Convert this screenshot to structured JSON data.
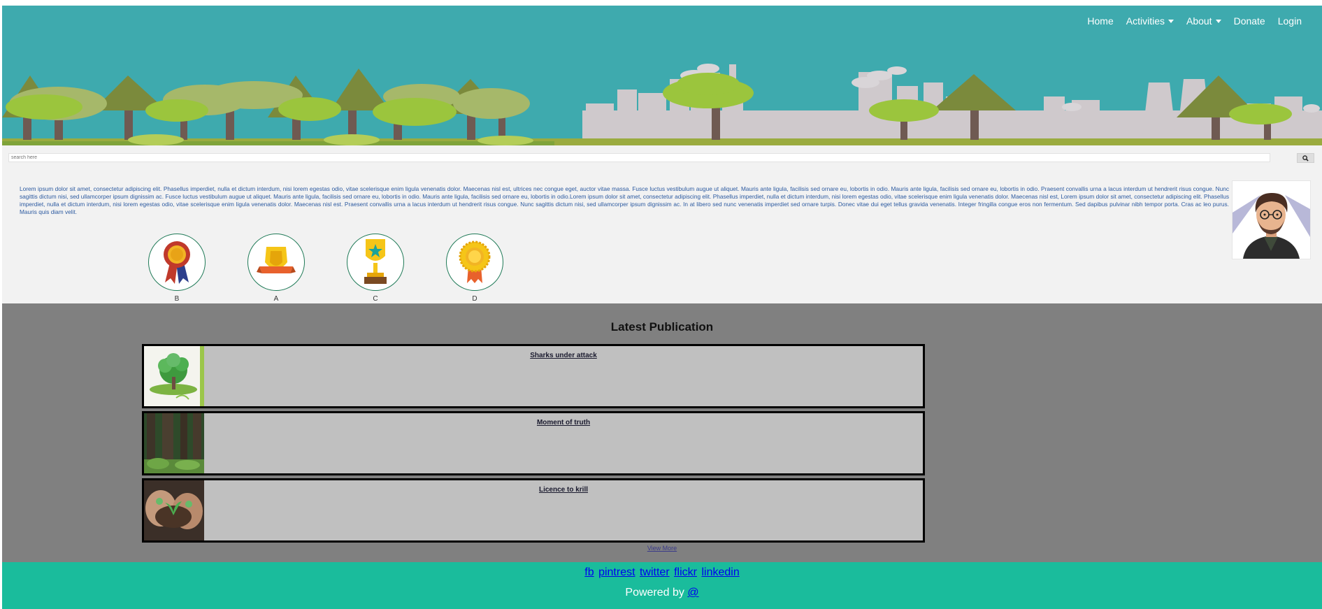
{
  "nav": {
    "items": [
      {
        "label": "Home",
        "dropdown": false
      },
      {
        "label": "Activities",
        "dropdown": true
      },
      {
        "label": "About",
        "dropdown": true
      },
      {
        "label": "Donate",
        "dropdown": false
      },
      {
        "label": "Login",
        "dropdown": false
      }
    ]
  },
  "search": {
    "placeholder": "search here",
    "button_icon": "search-icon"
  },
  "intro": {
    "text": "Lorem ipsum dolor sit amet, consectetur adipiscing elit. Phasellus imperdiet, nulla et dictum interdum, nisi lorem egestas odio, vitae scelerisque enim ligula venenatis dolor. Maecenas nisl est, ultrices nec congue eget, auctor vitae massa. Fusce luctus vestibulum augue ut aliquet. Mauris ante ligula, facilisis sed ornare eu, lobortis in odio. Mauris ante ligula, facilisis sed ornare eu, lobortis in odio. Praesent convallis urna a lacus interdum ut hendrerit risus congue. Nunc sagittis dictum nisi, sed ullamcorper ipsum dignissim ac. Fusce luctus vestibulum augue ut aliquet. Mauris ante ligula, facilisis sed ornare eu, lobortis in odio. Mauris ante ligula, facilisis sed ornare eu, lobortis in odio.Lorem ipsum dolor sit amet, consectetur adipiscing elit. Phasellus imperdiet, nulla et dictum interdum, nisi lorem egestas odio, vitae scelerisque enim ligula venenatis dolor. Maecenas nisl est, Lorem ipsum dolor sit amet, consectetur adipiscing elit. Phasellus imperdiet, nulla et dictum interdum, nisi lorem egestas odio, vitae scelerisque enim ligula venenatis dolor. Maecenas nisl est. Praesent convallis urna a lacus interdum ut hendrerit risus congue. Nunc sagittis dictum nisi, sed ullamcorper ipsum dignissim ac. In at libero sed nunc venenatis imperdiet sed ornare turpis. Donec vitae dui eget tellus gravida venenatis. Integer fringilla congue eros non fermentum. Sed dapibus pulvinar nibh tempor porta. Cras ac leo purus. Mauris quis diam velit."
  },
  "badges": [
    {
      "label": "B",
      "icon": "rosette-ribbon-icon"
    },
    {
      "label": "A",
      "icon": "shield-banner-icon"
    },
    {
      "label": "C",
      "icon": "star-trophy-icon"
    },
    {
      "label": "D",
      "icon": "medal-icon"
    }
  ],
  "publications": {
    "title": "Latest Publication",
    "items": [
      {
        "title": "Sharks under attack",
        "thumb": "green-earth-tree-image"
      },
      {
        "title": "Moment of truth",
        "thumb": "forest-image"
      },
      {
        "title": "Licence to krill",
        "thumb": "hands-seedling-image"
      }
    ],
    "view_more": "View More"
  },
  "footer": {
    "links": [
      "fb",
      "pintrest",
      "twitter",
      "flickr",
      "linkedin"
    ],
    "powered_label": "Powered by",
    "powered_link": "@"
  },
  "colors": {
    "banner": "#3eaaae",
    "footer": "#1abc9c",
    "pubs_bg": "#808080",
    "card_bg": "#c0c0c0"
  }
}
